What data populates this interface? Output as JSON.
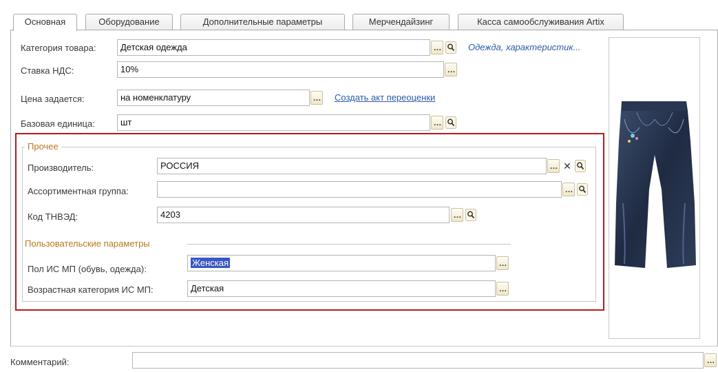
{
  "tabs": [
    {
      "label": "Основная"
    },
    {
      "label": "Оборудование"
    },
    {
      "label": "Дополнительные параметры"
    },
    {
      "label": "Мерчендайзинг"
    },
    {
      "label": "Касса самообслуживания Artix"
    }
  ],
  "form": {
    "category_label": "Категория товара:",
    "category_value": "Детская одежда",
    "category_link": "Одежда, характеристик...",
    "vat_label": "Ставка НДС:",
    "vat_value": "10%",
    "price_label": "Цена задается:",
    "price_value": "на номенклатуру",
    "price_link": "Создать акт переоценки",
    "unit_label": "Базовая единица:",
    "unit_value": "шт"
  },
  "other": {
    "title": "Прочее",
    "manufacturer_label": "Производитель:",
    "manufacturer_value": "РОССИЯ",
    "assortment_label": "Ассортиментная группа:",
    "assortment_value": "",
    "tnved_label": "Код ТНВЭД:",
    "tnved_value": "4203",
    "user_params_title": "Пользовательские параметры",
    "gender_label": "Пол ИС МП (обувь, одежда):",
    "gender_value": "Женская",
    "age_label": "Возрастная категория ИС МП:",
    "age_value": "Детская"
  },
  "comment": {
    "label": "Комментарий:",
    "value": ""
  },
  "colors": {
    "highlight_border": "#b01c1c",
    "link": "#2c5aa8",
    "group_title": "#b8781f",
    "selection": "#3a57c2"
  },
  "icons": [
    "ellipsis-icon",
    "search-icon",
    "clear-icon",
    "jeans-product-image"
  ]
}
